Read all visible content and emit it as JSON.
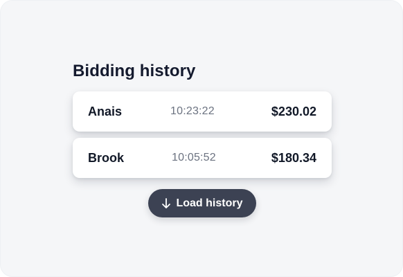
{
  "page": {
    "title": "Bidding history"
  },
  "bids": [
    {
      "name": "Anais",
      "time": "10:23:22",
      "amount": "$230.02"
    },
    {
      "name": "Brook",
      "time": "10:05:52",
      "amount": "$180.34"
    }
  ],
  "actions": {
    "load_history_label": "Load history",
    "load_history_icon": "arrow-down-icon"
  },
  "colors": {
    "background": "#f5f6f8",
    "card": "#ffffff",
    "title": "#141a2e",
    "text_primary": "#111827",
    "text_secondary": "#6b7280",
    "button_bg": "#3c4253",
    "button_text": "#ffffff"
  }
}
